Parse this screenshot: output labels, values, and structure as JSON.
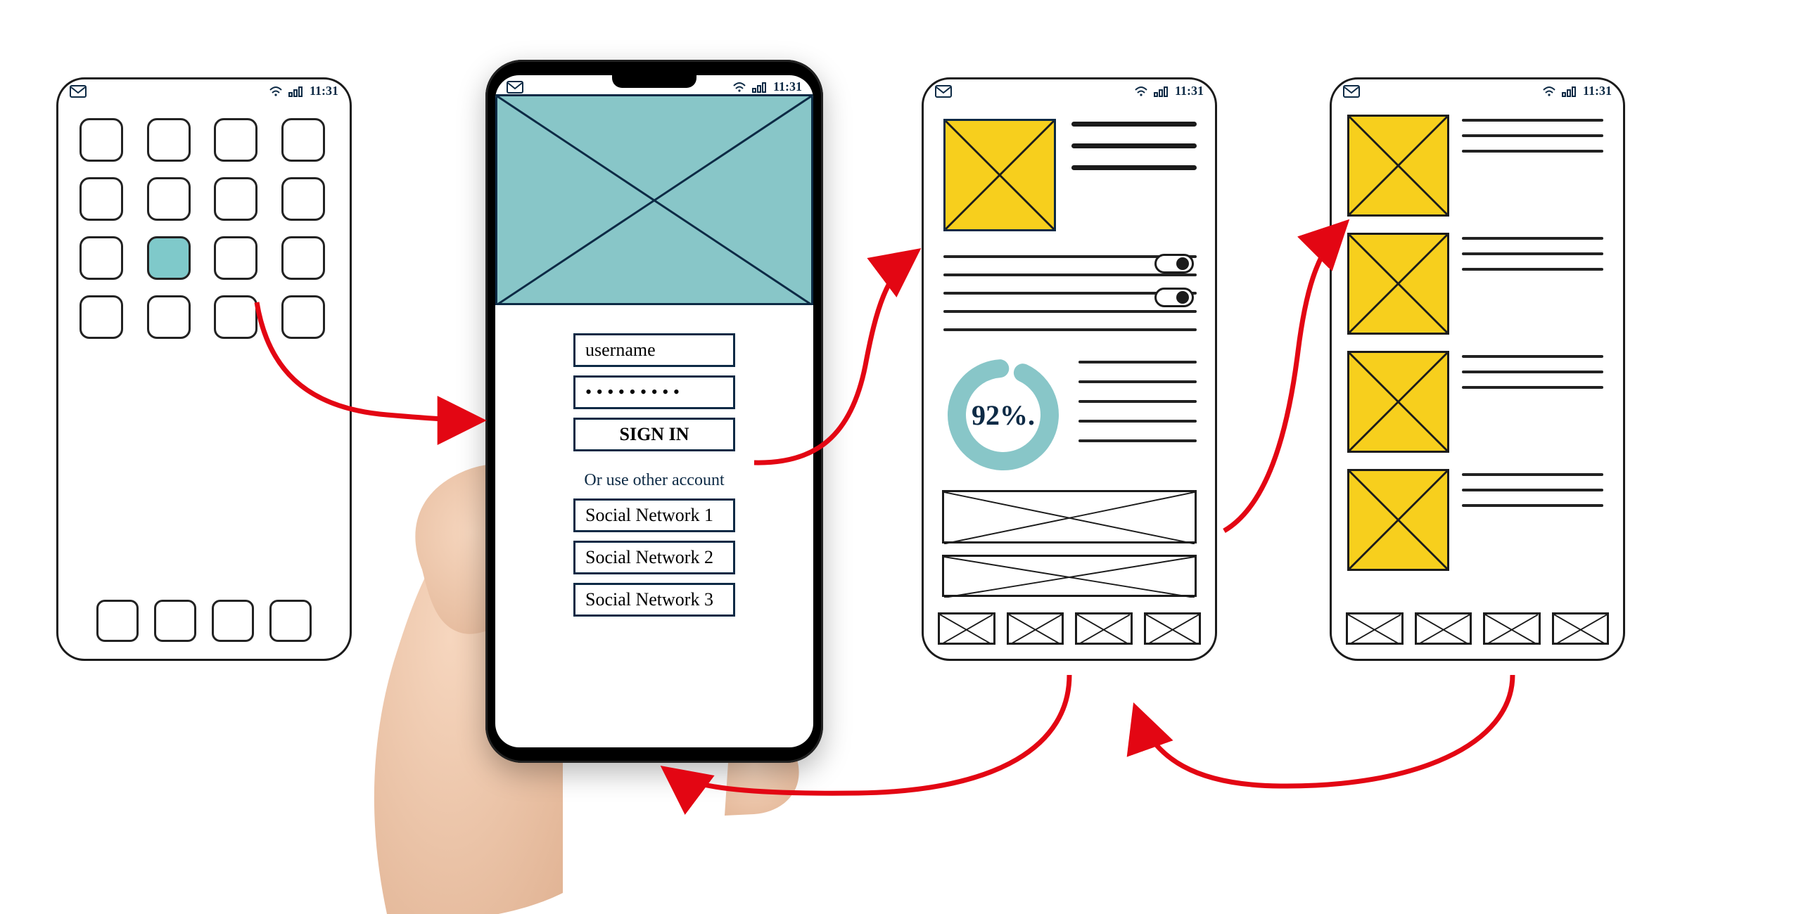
{
  "colors": {
    "teal": "#88c6c8",
    "yellow": "#f7cf1d",
    "arrow": "#e30613",
    "ink": "#0d2a45"
  },
  "statusbar": {
    "time": "11:31"
  },
  "screen1": {
    "highlighted_app_index": 9
  },
  "screen2": {
    "username_label": "username",
    "password_masked": "• • • • • • • • •",
    "signin_label": "SIGN IN",
    "alt_label": "Or use other account",
    "social": [
      "Social Network 1",
      "Social Network 2",
      "Social Network 3"
    ]
  },
  "screen3": {
    "toggles": [
      true,
      true
    ],
    "progress_percent": "92%."
  },
  "screen4": {}
}
